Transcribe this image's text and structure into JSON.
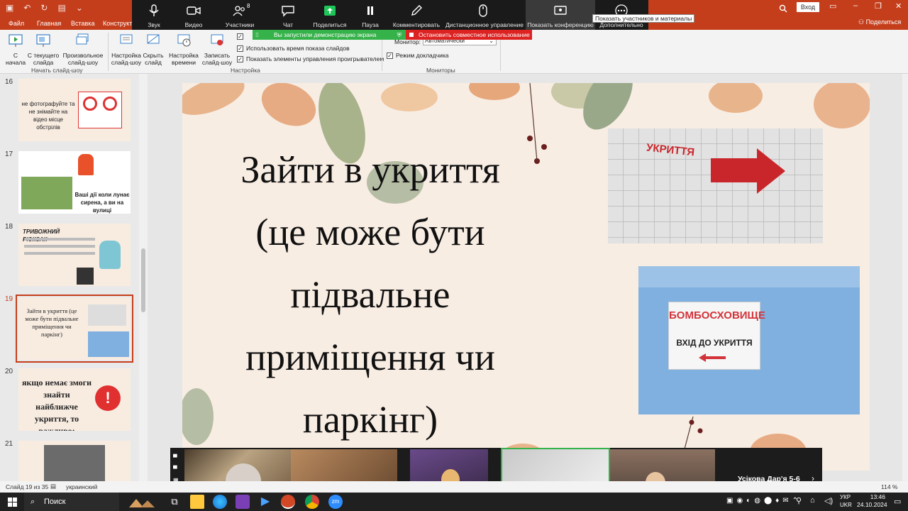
{
  "ribbon_tabs": [
    "Файл",
    "Главная",
    "Вставка",
    "Конструктор"
  ],
  "title_bar": {
    "sign_in": "Вход",
    "share": "Поделиться"
  },
  "zoom": {
    "buttons": [
      {
        "label": "Звук",
        "icon": "microphone-icon"
      },
      {
        "label": "Видео",
        "icon": "video-camera-icon"
      },
      {
        "label": "Участники",
        "icon": "participants-icon",
        "count": "8"
      },
      {
        "label": "Чат",
        "icon": "chat-icon"
      },
      {
        "label": "Поделиться",
        "icon": "share-screen-icon"
      },
      {
        "label": "Пауза",
        "icon": "pause-icon"
      },
      {
        "label": "Комментировать",
        "icon": "pencil-icon"
      },
      {
        "label": "Дистанционное управление",
        "icon": "mouse-icon"
      },
      {
        "label": "Показать конференцию",
        "icon": "monitor-icon"
      },
      {
        "label": "Дополнительно",
        "icon": "more-icon"
      }
    ],
    "tooltip": "Показать участников и материалы",
    "share_banner": "Вы запустили демонстрацию экрана",
    "stop_banner": "Остановить совместное использование"
  },
  "ribbon": {
    "from_start": [
      "С",
      "начала"
    ],
    "from_current": [
      "С текущего",
      "слайда"
    ],
    "custom_show": [
      "Произвольное",
      "слайд-шоу"
    ],
    "group_start": "Начать слайд-шоу",
    "setup_show": [
      "Настройка",
      "слайд-шоу"
    ],
    "hide_slide": [
      "Скрыть",
      "слайд"
    ],
    "rehearse": [
      "Настройка",
      "времени"
    ],
    "record": [
      "Записать",
      "слайд-шоу"
    ],
    "check_timings": "Использовать время показа слайдов",
    "check_controls": "Показать элементы управления проигрывателем",
    "group_setup": "Настройка",
    "monitor_label": "Монитор:",
    "monitor_value": "Автоматически",
    "presenter_view": "Режим докладчика",
    "group_monitors": "Мониторы"
  },
  "thumbnails": [
    {
      "num": "16",
      "text": "не фотографуйте та не знімайте на відео місце обстрілів"
    },
    {
      "num": "17",
      "text": "Ваші дії коли лунає сирена, а ви на вулиці"
    },
    {
      "num": "18",
      "text": "ТРИВОЖНИЙ РЮКЗАК"
    },
    {
      "num": "19",
      "text": "Зайти в укриття (це може бути підвальне приміщення чи паркінг)"
    },
    {
      "num": "20",
      "text": "якщо немає змоги знайти найближче укриття, то важливо:"
    },
    {
      "num": "21",
      "text": ""
    }
  ],
  "slide": {
    "title_lines": [
      "Зайти в укриття",
      "(це може бути",
      "підвальне",
      "приміщення чи",
      "паркінг)"
    ],
    "sign1_text": "УКРИТТЯ",
    "sign2_line1": "БОМБОСХОВИЩЕ",
    "sign2_line2": "ВХІД ДО УКРИТТЯ"
  },
  "gallery": {
    "active_speaker": "Усікова Дар'я 5-6"
  },
  "status": {
    "slide_info": "Слайд 19 из 35",
    "language": "украинский",
    "zoom": "114 %"
  },
  "taskbar": {
    "search": "Поиск",
    "lang_top": "УКР",
    "lang_bottom": "UKR",
    "time": "13:46",
    "date": "24.10.2024"
  },
  "colors": {
    "ribbon_accent": "#c43e1c",
    "zoom_bg": "#1a1a1a",
    "share_green": "#36b24a",
    "stop_red": "#dd2222"
  }
}
